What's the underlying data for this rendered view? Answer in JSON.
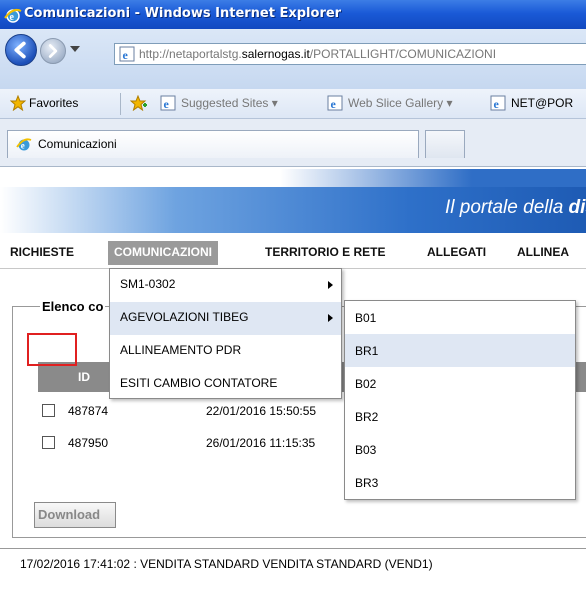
{
  "window": {
    "title": "Comunicazioni - Windows Internet Explorer"
  },
  "address": {
    "prefix": "http://netaportalstg.",
    "domain": "salernogas.it",
    "path": "/PORTALLIGHT/COMUNICAZIONI"
  },
  "favorites": {
    "label": "Favorites",
    "items": [
      {
        "label": "Suggested Sites ▾"
      },
      {
        "label": "Web Slice Gallery ▾"
      },
      {
        "label": "NET@POR"
      }
    ]
  },
  "tabs": [
    {
      "label": "Comunicazioni"
    }
  ],
  "banner": {
    "slogan_prefix": "Il portale della ",
    "slogan_bold": "dis"
  },
  "menu": {
    "items": [
      {
        "label": "RICHIESTE"
      },
      {
        "label": "COMUNICAZIONI"
      },
      {
        "label": "TERRITORIO E RETE"
      },
      {
        "label": "ALLEGATI"
      },
      {
        "label": "ALLINEA"
      }
    ]
  },
  "dropdown": {
    "items": [
      {
        "label": "SM1-0302",
        "has_submenu": true
      },
      {
        "label": "AGEVOLAZIONI TIBEG",
        "has_submenu": true
      },
      {
        "label": "ALLINEAMENTO PDR"
      },
      {
        "label": "ESITI CAMBIO CONTATORE"
      }
    ]
  },
  "submenu": {
    "items": [
      {
        "label": "B01"
      },
      {
        "label": "BR1"
      },
      {
        "label": "B02"
      },
      {
        "label": "BR2"
      },
      {
        "label": "B03"
      },
      {
        "label": "BR3"
      }
    ]
  },
  "section": {
    "title": "Elenco co"
  },
  "table": {
    "headers": {
      "id": "ID"
    },
    "rows": [
      {
        "id": "487874",
        "date": "22/01/2016 15:50:55"
      },
      {
        "id": "487950",
        "date": "26/01/2016 11:15:35"
      }
    ]
  },
  "download_label": "Download",
  "status": {
    "text": "17/02/2016 17:41:02  :   VENDITA STANDARD VENDITA STANDARD   (VEND1)"
  },
  "colors": {
    "title_bar": "#1a5ad7",
    "menu_active": "#9a9a9a",
    "highlight": "#dfe7f3",
    "marker": "#e02020"
  }
}
